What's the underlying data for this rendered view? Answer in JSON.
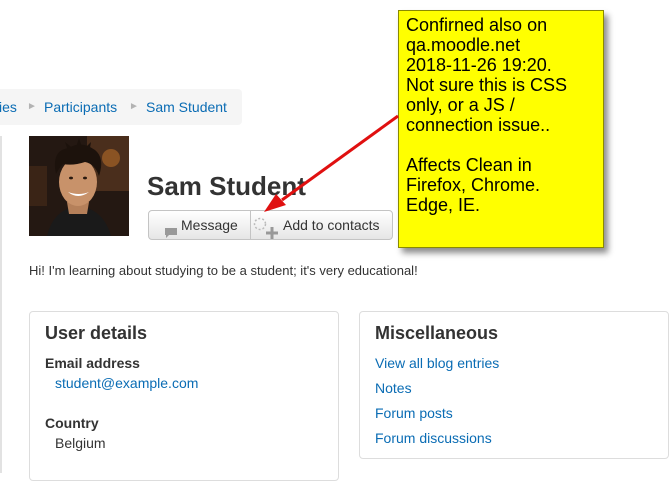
{
  "breadcrumb": {
    "items": [
      "ies",
      "Participants",
      "Sam Student"
    ],
    "separator": "►"
  },
  "profile": {
    "fullname": "Sam Student",
    "description": "Hi! I'm learning about studying to be a student; it's very educational!"
  },
  "actions": {
    "message_label": "Message",
    "add_contacts_label": "Add to contacts"
  },
  "user_details": {
    "title": "User details",
    "email_label": "Email address",
    "email_value": "student@example.com",
    "country_label": "Country",
    "country_value": "Belgium"
  },
  "misc": {
    "title": "Miscellaneous",
    "links": [
      "View all blog entries",
      "Notes",
      "Forum posts",
      "Forum discussions"
    ]
  },
  "annotation": {
    "lines": [
      "Confirned also on",
      "qa.moodle.net",
      "2018-11-26 19:20.",
      "Not sure this is CSS",
      "only, or a JS /",
      "connection issue..",
      "",
      "Affects Clean in",
      "Firefox, Chrome.",
      "Edge, IE."
    ]
  },
  "colors": {
    "link": "#0a6cb4",
    "note_background": "#ffff00",
    "arrow": "#e01010",
    "breadcrumb_background": "#f5f5f5"
  },
  "icons": {
    "message": "speech-bubble-icon",
    "add_contact": "plus-icon",
    "loading": "spinner-icon"
  }
}
